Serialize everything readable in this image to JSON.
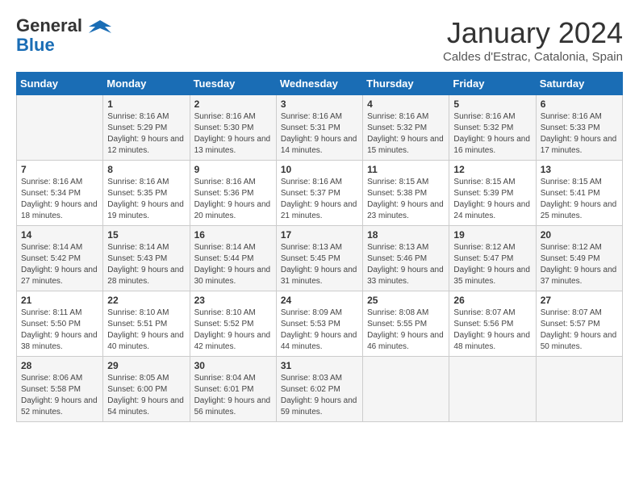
{
  "logo": {
    "line1": "General",
    "line2": "Blue"
  },
  "title": "January 2024",
  "location": "Caldes d'Estrac, Catalonia, Spain",
  "weekdays": [
    "Sunday",
    "Monday",
    "Tuesday",
    "Wednesday",
    "Thursday",
    "Friday",
    "Saturday"
  ],
  "weeks": [
    [
      {
        "day": "",
        "sunrise": "",
        "sunset": "",
        "daylight": ""
      },
      {
        "day": "1",
        "sunrise": "Sunrise: 8:16 AM",
        "sunset": "Sunset: 5:29 PM",
        "daylight": "Daylight: 9 hours and 12 minutes."
      },
      {
        "day": "2",
        "sunrise": "Sunrise: 8:16 AM",
        "sunset": "Sunset: 5:30 PM",
        "daylight": "Daylight: 9 hours and 13 minutes."
      },
      {
        "day": "3",
        "sunrise": "Sunrise: 8:16 AM",
        "sunset": "Sunset: 5:31 PM",
        "daylight": "Daylight: 9 hours and 14 minutes."
      },
      {
        "day": "4",
        "sunrise": "Sunrise: 8:16 AM",
        "sunset": "Sunset: 5:32 PM",
        "daylight": "Daylight: 9 hours and 15 minutes."
      },
      {
        "day": "5",
        "sunrise": "Sunrise: 8:16 AM",
        "sunset": "Sunset: 5:32 PM",
        "daylight": "Daylight: 9 hours and 16 minutes."
      },
      {
        "day": "6",
        "sunrise": "Sunrise: 8:16 AM",
        "sunset": "Sunset: 5:33 PM",
        "daylight": "Daylight: 9 hours and 17 minutes."
      }
    ],
    [
      {
        "day": "7",
        "sunrise": "Sunrise: 8:16 AM",
        "sunset": "Sunset: 5:34 PM",
        "daylight": "Daylight: 9 hours and 18 minutes."
      },
      {
        "day": "8",
        "sunrise": "Sunrise: 8:16 AM",
        "sunset": "Sunset: 5:35 PM",
        "daylight": "Daylight: 9 hours and 19 minutes."
      },
      {
        "day": "9",
        "sunrise": "Sunrise: 8:16 AM",
        "sunset": "Sunset: 5:36 PM",
        "daylight": "Daylight: 9 hours and 20 minutes."
      },
      {
        "day": "10",
        "sunrise": "Sunrise: 8:16 AM",
        "sunset": "Sunset: 5:37 PM",
        "daylight": "Daylight: 9 hours and 21 minutes."
      },
      {
        "day": "11",
        "sunrise": "Sunrise: 8:15 AM",
        "sunset": "Sunset: 5:38 PM",
        "daylight": "Daylight: 9 hours and 23 minutes."
      },
      {
        "day": "12",
        "sunrise": "Sunrise: 8:15 AM",
        "sunset": "Sunset: 5:39 PM",
        "daylight": "Daylight: 9 hours and 24 minutes."
      },
      {
        "day": "13",
        "sunrise": "Sunrise: 8:15 AM",
        "sunset": "Sunset: 5:41 PM",
        "daylight": "Daylight: 9 hours and 25 minutes."
      }
    ],
    [
      {
        "day": "14",
        "sunrise": "Sunrise: 8:14 AM",
        "sunset": "Sunset: 5:42 PM",
        "daylight": "Daylight: 9 hours and 27 minutes."
      },
      {
        "day": "15",
        "sunrise": "Sunrise: 8:14 AM",
        "sunset": "Sunset: 5:43 PM",
        "daylight": "Daylight: 9 hours and 28 minutes."
      },
      {
        "day": "16",
        "sunrise": "Sunrise: 8:14 AM",
        "sunset": "Sunset: 5:44 PM",
        "daylight": "Daylight: 9 hours and 30 minutes."
      },
      {
        "day": "17",
        "sunrise": "Sunrise: 8:13 AM",
        "sunset": "Sunset: 5:45 PM",
        "daylight": "Daylight: 9 hours and 31 minutes."
      },
      {
        "day": "18",
        "sunrise": "Sunrise: 8:13 AM",
        "sunset": "Sunset: 5:46 PM",
        "daylight": "Daylight: 9 hours and 33 minutes."
      },
      {
        "day": "19",
        "sunrise": "Sunrise: 8:12 AM",
        "sunset": "Sunset: 5:47 PM",
        "daylight": "Daylight: 9 hours and 35 minutes."
      },
      {
        "day": "20",
        "sunrise": "Sunrise: 8:12 AM",
        "sunset": "Sunset: 5:49 PM",
        "daylight": "Daylight: 9 hours and 37 minutes."
      }
    ],
    [
      {
        "day": "21",
        "sunrise": "Sunrise: 8:11 AM",
        "sunset": "Sunset: 5:50 PM",
        "daylight": "Daylight: 9 hours and 38 minutes."
      },
      {
        "day": "22",
        "sunrise": "Sunrise: 8:10 AM",
        "sunset": "Sunset: 5:51 PM",
        "daylight": "Daylight: 9 hours and 40 minutes."
      },
      {
        "day": "23",
        "sunrise": "Sunrise: 8:10 AM",
        "sunset": "Sunset: 5:52 PM",
        "daylight": "Daylight: 9 hours and 42 minutes."
      },
      {
        "day": "24",
        "sunrise": "Sunrise: 8:09 AM",
        "sunset": "Sunset: 5:53 PM",
        "daylight": "Daylight: 9 hours and 44 minutes."
      },
      {
        "day": "25",
        "sunrise": "Sunrise: 8:08 AM",
        "sunset": "Sunset: 5:55 PM",
        "daylight": "Daylight: 9 hours and 46 minutes."
      },
      {
        "day": "26",
        "sunrise": "Sunrise: 8:07 AM",
        "sunset": "Sunset: 5:56 PM",
        "daylight": "Daylight: 9 hours and 48 minutes."
      },
      {
        "day": "27",
        "sunrise": "Sunrise: 8:07 AM",
        "sunset": "Sunset: 5:57 PM",
        "daylight": "Daylight: 9 hours and 50 minutes."
      }
    ],
    [
      {
        "day": "28",
        "sunrise": "Sunrise: 8:06 AM",
        "sunset": "Sunset: 5:58 PM",
        "daylight": "Daylight: 9 hours and 52 minutes."
      },
      {
        "day": "29",
        "sunrise": "Sunrise: 8:05 AM",
        "sunset": "Sunset: 6:00 PM",
        "daylight": "Daylight: 9 hours and 54 minutes."
      },
      {
        "day": "30",
        "sunrise": "Sunrise: 8:04 AM",
        "sunset": "Sunset: 6:01 PM",
        "daylight": "Daylight: 9 hours and 56 minutes."
      },
      {
        "day": "31",
        "sunrise": "Sunrise: 8:03 AM",
        "sunset": "Sunset: 6:02 PM",
        "daylight": "Daylight: 9 hours and 59 minutes."
      },
      {
        "day": "",
        "sunrise": "",
        "sunset": "",
        "daylight": ""
      },
      {
        "day": "",
        "sunrise": "",
        "sunset": "",
        "daylight": ""
      },
      {
        "day": "",
        "sunrise": "",
        "sunset": "",
        "daylight": ""
      }
    ]
  ]
}
